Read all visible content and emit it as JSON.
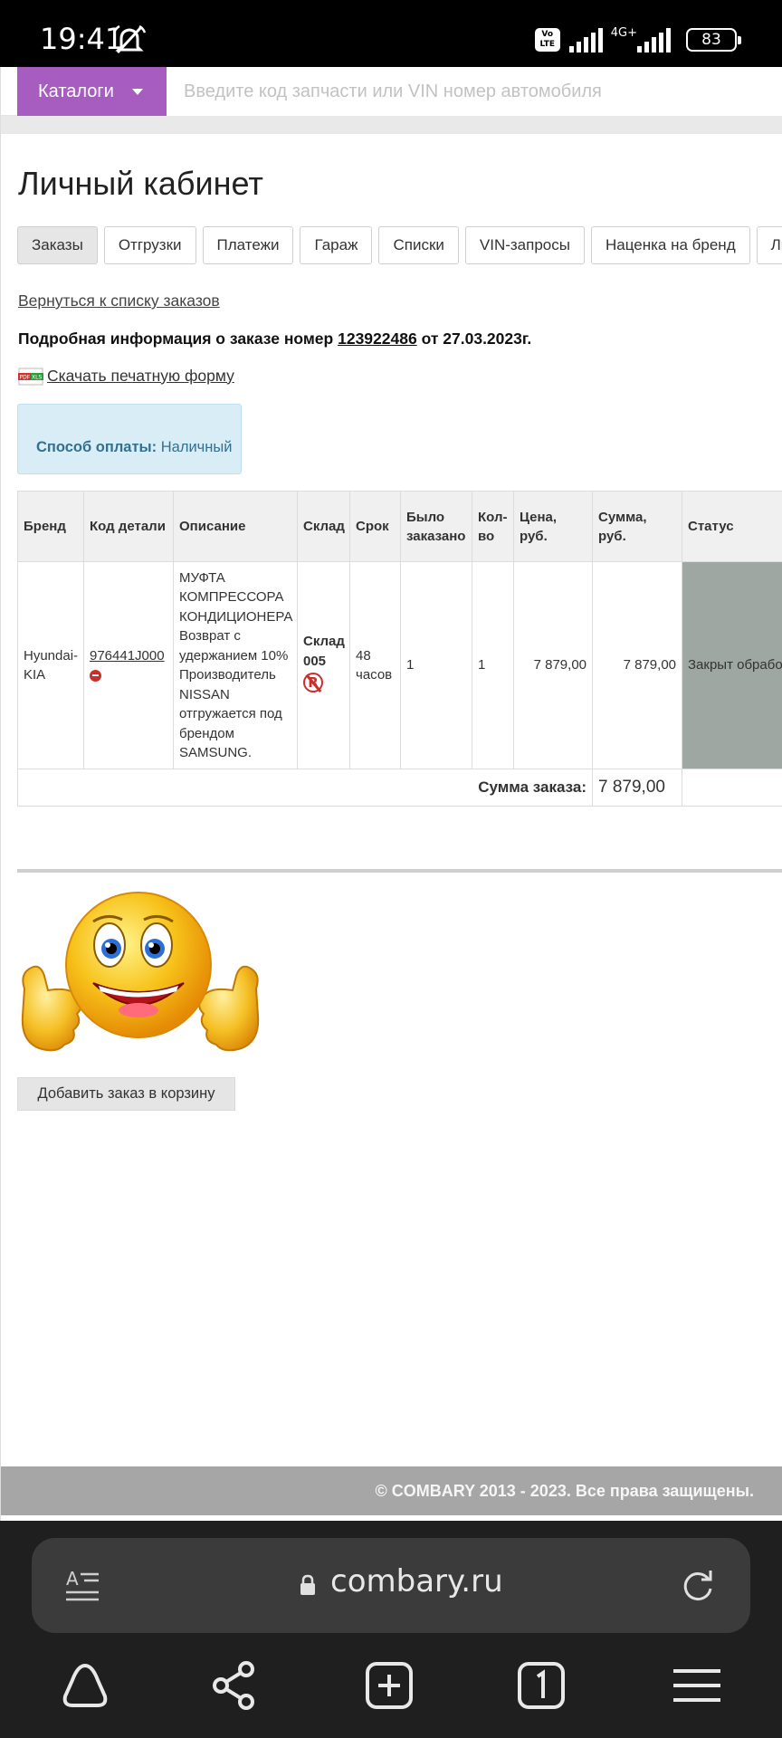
{
  "status_bar": {
    "time": "19:41",
    "volte": "Vo LTE",
    "network": "4G+",
    "battery": "83"
  },
  "header": {
    "catalog_label": "Каталоги",
    "search_placeholder": "Введите код запчасти или VIN номер автомобиля"
  },
  "page_title": "Личный кабинет",
  "tabs": [
    {
      "label": "Заказы",
      "active": true
    },
    {
      "label": "Отгрузки"
    },
    {
      "label": "Платежи"
    },
    {
      "label": "Гараж"
    },
    {
      "label": "Списки"
    },
    {
      "label": "VIN-запросы"
    },
    {
      "label": "Наценка на бренд"
    },
    {
      "label": "Лич"
    }
  ],
  "back_link": "Вернуться к списку заказов",
  "order": {
    "prefix": "Подробная информация о заказе номер",
    "number": "123922486",
    "suffix": "от 27.03.2023г."
  },
  "download_label": "Скачать печатную форму",
  "payment": {
    "label": "Способ оплаты:",
    "value": "Наличный"
  },
  "table": {
    "headers": [
      "Бренд",
      "Код детали",
      "Описание",
      "Склад",
      "Срок",
      "Было заказано",
      "Кол-во",
      "Цена, руб.",
      "Сумма, руб.",
      "Статус"
    ],
    "rows": [
      {
        "brand": "Hyundai-KIA",
        "code": "976441J000",
        "description": "МУФТА КОМПРЕССОРА КОНДИЦИОНЕРА Возврат с удержанием 10% Производитель NISSAN отгружается под брендом SAMSUNG.",
        "warehouse": "Склад 005",
        "term": "48 часов",
        "ordered": "1",
        "qty": "1",
        "price": "7 879,00",
        "sum": "7 879,00",
        "status": "Закрыт обрабо"
      }
    ],
    "total_label": "Сумма заказа:",
    "total_value": "7 879,00"
  },
  "add_to_cart": "Добавить заказ в корзину",
  "footer": "© COMBARY  2013 - 2023. Все права защищены.",
  "browser": {
    "url": "combary.ru"
  }
}
